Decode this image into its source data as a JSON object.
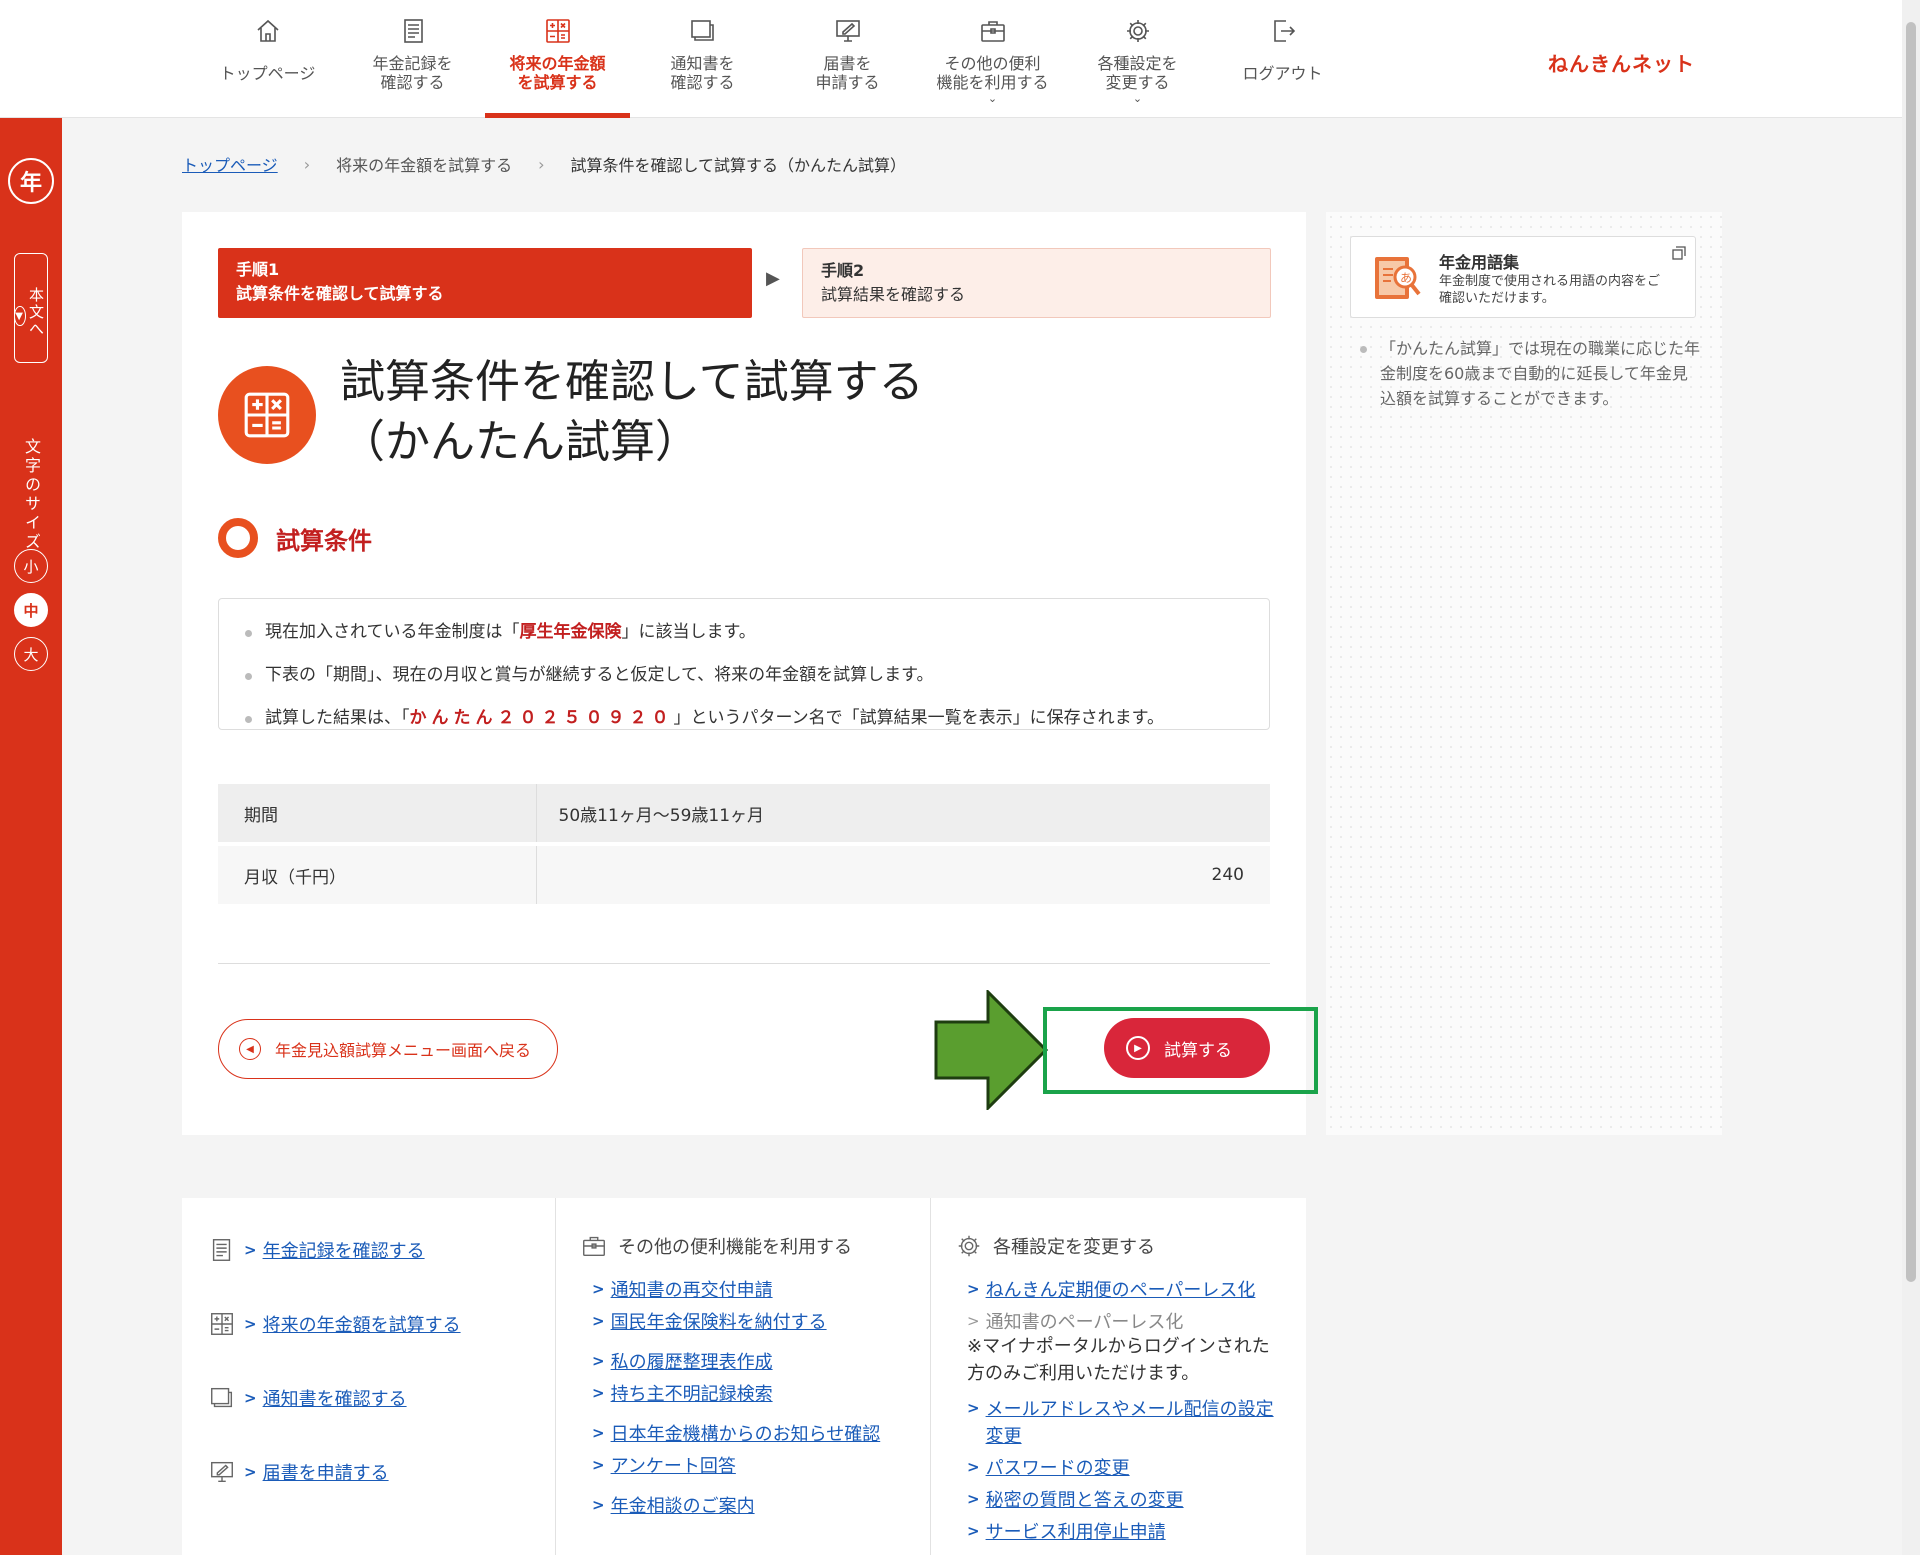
{
  "header": {
    "brand": "ねんきんネット",
    "nav": [
      {
        "line1": "トップページ",
        "line2": ""
      },
      {
        "line1": "年金記録を",
        "line2": "確認する"
      },
      {
        "line1": "将来の年金額",
        "line2": "を試算する"
      },
      {
        "line1": "通知書を",
        "line2": "確認する"
      },
      {
        "line1": "届書を",
        "line2": "申請する"
      },
      {
        "line1": "その他の便利",
        "line2": "機能を利用する"
      },
      {
        "line1": "各種設定を",
        "line2": "変更する"
      },
      {
        "line1": "ログアウト",
        "line2": ""
      }
    ]
  },
  "rail": {
    "skip_label": "本文へ",
    "size_label": "文字のサイズ",
    "sizes": [
      "小",
      "中",
      "大"
    ]
  },
  "breadcrumb": {
    "home": "トップページ",
    "parent": "将来の年金額を試算する",
    "current": "試算条件を確認して試算する（かんたん試算）"
  },
  "steps": {
    "step1_num": "手順1",
    "step1_label": "試算条件を確認して試算する",
    "step2_num": "手順2",
    "step2_label": "試算結果を確認する"
  },
  "page": {
    "title_line1": "試算条件を確認して試算する",
    "title_line2": "（かんたん試算）",
    "section_heading": "試算条件"
  },
  "info": {
    "l1_pre": "現在加入されている年金制度は「",
    "l1_em": "厚生年金保険",
    "l1_post": "」に該当します。",
    "l2": "下表の「期間」、現在の月収と賞与が継続すると仮定して、将来の年金額を試算します。",
    "l3_pre": "試算した結果は、「",
    "l3_em": "かんたん２０２５０９２０",
    "l3_post": "」というパターン名で「試算結果一覧を表示」に保存されます。"
  },
  "table": {
    "row1_label": "期間",
    "row1_value": "50歳11ヶ月～59歳11ヶ月",
    "row2_label": "月収（千円）",
    "row2_value": "240"
  },
  "buttons": {
    "back": "年金見込額試算メニュー画面へ戻る",
    "calc": "試算する"
  },
  "side": {
    "glossary_title": "年金用語集",
    "glossary_desc": "年金制度で使用される用語の内容をご確認いただけます。",
    "note": "「かんたん試算」では現在の職業に応じた年金制度を60歳まで自動的に延長して年金見込額を試算することができます。"
  },
  "footer": {
    "col1": [
      "年金記録を確認する",
      "将来の年金額を試算する",
      "通知書を確認する",
      "届書を申請する"
    ],
    "col2_head": "その他の便利機能を利用する",
    "col2": [
      "通知書の再交付申請",
      "国民年金保険料を納付する",
      "私の履歴整理表作成",
      "持ち主不明記録検索",
      "日本年金機構からのお知らせ確認",
      "アンケート回答",
      "年金相談のご案内"
    ],
    "col3_head": "各種設定を変更する",
    "col3_link1": "ねんきん定期便のペーパーレス化",
    "col3_disabled": "通知書のペーパーレス化",
    "col3_note_line1": "※マイナポータルからログインされた",
    "col3_note_line2": "方のみご利用いただけます。",
    "col3_link2_line1": "メールアドレスやメール配信の設定",
    "col3_link2_line2": "変更",
    "col3_links": [
      "パスワードの変更",
      "秘密の質問と答えの変更",
      "サービス利用停止申請"
    ]
  },
  "colors": {
    "accent": "#d9321a",
    "button": "#d9263a",
    "highlight": "#1aa34a",
    "link": "#1a5bb8"
  }
}
